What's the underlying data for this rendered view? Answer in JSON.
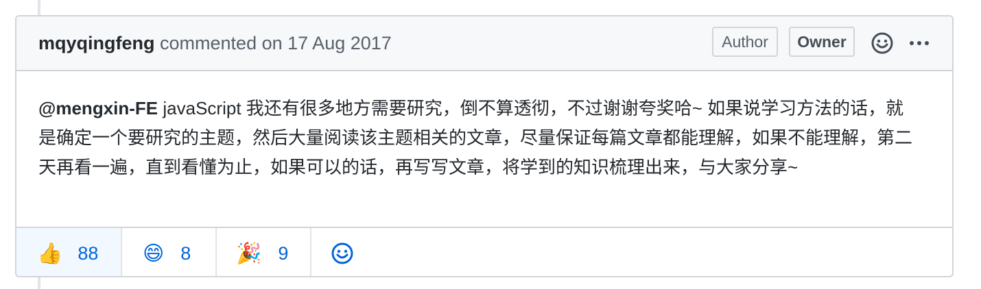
{
  "comment": {
    "author": "mqyqingfeng",
    "action": "commented on",
    "date": "17 Aug 2017",
    "labels": {
      "author": "Author",
      "owner": "Owner"
    },
    "mention": "@mengxin-FE",
    "body": " javaScript 我还有很多地方需要研究，倒不算透彻，不过谢谢夸奖哈~ 如果说学习方法的话，就是确定一个要研究的主题，然后大量阅读该主题相关的文章，尽量保证每篇文章都能理解，如果不能理解，第二天再看一遍，直到看懂为止，如果可以的话，再写写文章，将学到的知识梳理出来，与大家分享~"
  },
  "reactions": [
    {
      "icon": "thumbs-up-icon",
      "emoji": "👍",
      "count": "88",
      "active": true
    },
    {
      "icon": "smile-icon",
      "emoji": "😄",
      "count": "8",
      "active": false
    },
    {
      "icon": "tada-icon",
      "emoji": "🎉",
      "count": "9",
      "active": false
    }
  ],
  "colors": {
    "link": "#0366d6",
    "border": "#d1d5da",
    "header_bg": "#f6f8fa",
    "active_bg": "#f1f8ff"
  }
}
